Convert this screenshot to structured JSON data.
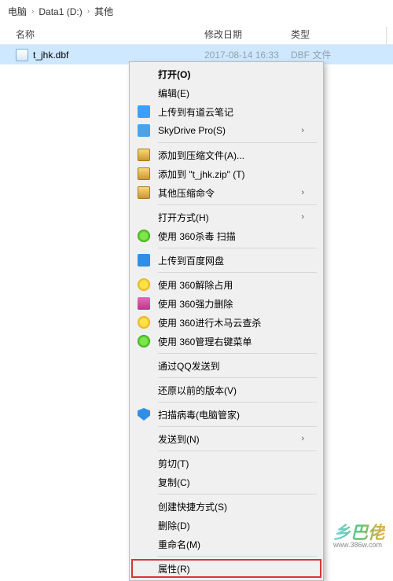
{
  "breadcrumb": {
    "seg1": "电脑",
    "seg2": "Data1 (D:)",
    "seg3": "其他"
  },
  "columns": {
    "name": "名称",
    "date": "修改日期",
    "type": "类型"
  },
  "file": {
    "name": "t_jhk.dbf",
    "date": "2017-08-14 16:33",
    "type": "DBF 文件"
  },
  "menu": {
    "open": "打开(O)",
    "edit": "编辑(E)",
    "uploadYoudao": "上传到有道云笔记",
    "skydrive": "SkyDrive Pro(S)",
    "addToArchive": "添加到压缩文件(A)...",
    "addToZip": "添加到 \"t_jhk.zip\" (T)",
    "otherCompress": "其他压缩命令",
    "openWith": "打开方式(H)",
    "scan360": "使用 360杀毒 扫描",
    "uploadBaidu": "上传到百度网盘",
    "release360": "使用 360解除占用",
    "forceDel360": "使用 360强力删除",
    "trojan360": "使用 360进行木马云查杀",
    "manage360": "使用 360管理右键菜单",
    "sendQQ": "通过QQ发送到",
    "restore": "还原以前的版本(V)",
    "scanVirus": "扫描病毒(电脑管家)",
    "sendTo": "发送到(N)",
    "cut": "剪切(T)",
    "copy": "复制(C)",
    "createShortcut": "创建快捷方式(S)",
    "delete": "删除(D)",
    "rename": "重命名(M)",
    "properties": "属性(R)"
  },
  "watermark": {
    "main": "乡巴佬",
    "sub": "www.386w.com"
  }
}
